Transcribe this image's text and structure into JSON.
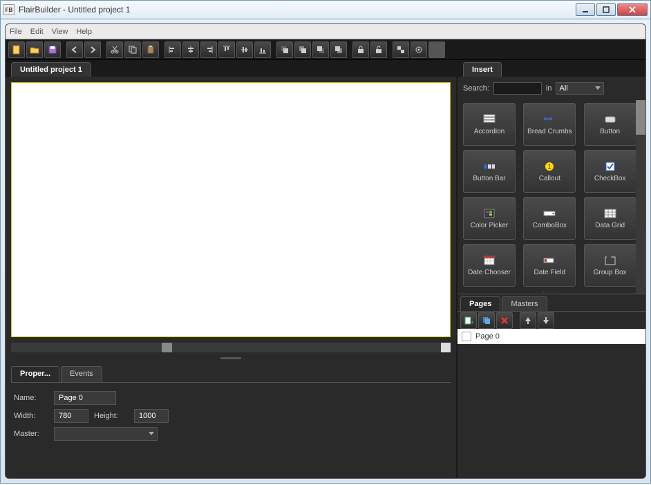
{
  "window": {
    "app_icon_text": "FB",
    "title": "FlairBuilder  - Untitled project 1"
  },
  "menubar": [
    "File",
    "Edit",
    "View",
    "Help"
  ],
  "canvas": {
    "tab_label": "Untitled project 1"
  },
  "properties": {
    "tabs": {
      "properties": "Proper...",
      "events": "Events"
    },
    "name_label": "Name:",
    "name_value": "Page 0",
    "width_label": "Width:",
    "width_value": "780",
    "height_label": "Height:",
    "height_value": "1000",
    "master_label": "Master:",
    "master_value": ""
  },
  "insert": {
    "tab_label": "Insert",
    "search_label": "Search:",
    "search_value": "",
    "in_label": "in",
    "filter_value": "All",
    "components": [
      {
        "name": "accordion",
        "label": "Accordion"
      },
      {
        "name": "bread-crumbs",
        "label": "Bread Crumbs"
      },
      {
        "name": "button",
        "label": "Button"
      },
      {
        "name": "button-bar",
        "label": "Button Bar"
      },
      {
        "name": "callout",
        "label": "Callout"
      },
      {
        "name": "checkbox",
        "label": "CheckBox"
      },
      {
        "name": "color-picker",
        "label": "Color Picker"
      },
      {
        "name": "combobox",
        "label": "ComboBox"
      },
      {
        "name": "data-grid",
        "label": "Data Grid"
      },
      {
        "name": "date-chooser",
        "label": "Date Chooser"
      },
      {
        "name": "date-field",
        "label": "Date Field"
      },
      {
        "name": "group-box",
        "label": "Group Box"
      }
    ]
  },
  "pages_panel": {
    "tabs": {
      "pages": "Pages",
      "masters": "Masters"
    },
    "items": [
      {
        "label": "Page 0"
      }
    ]
  }
}
